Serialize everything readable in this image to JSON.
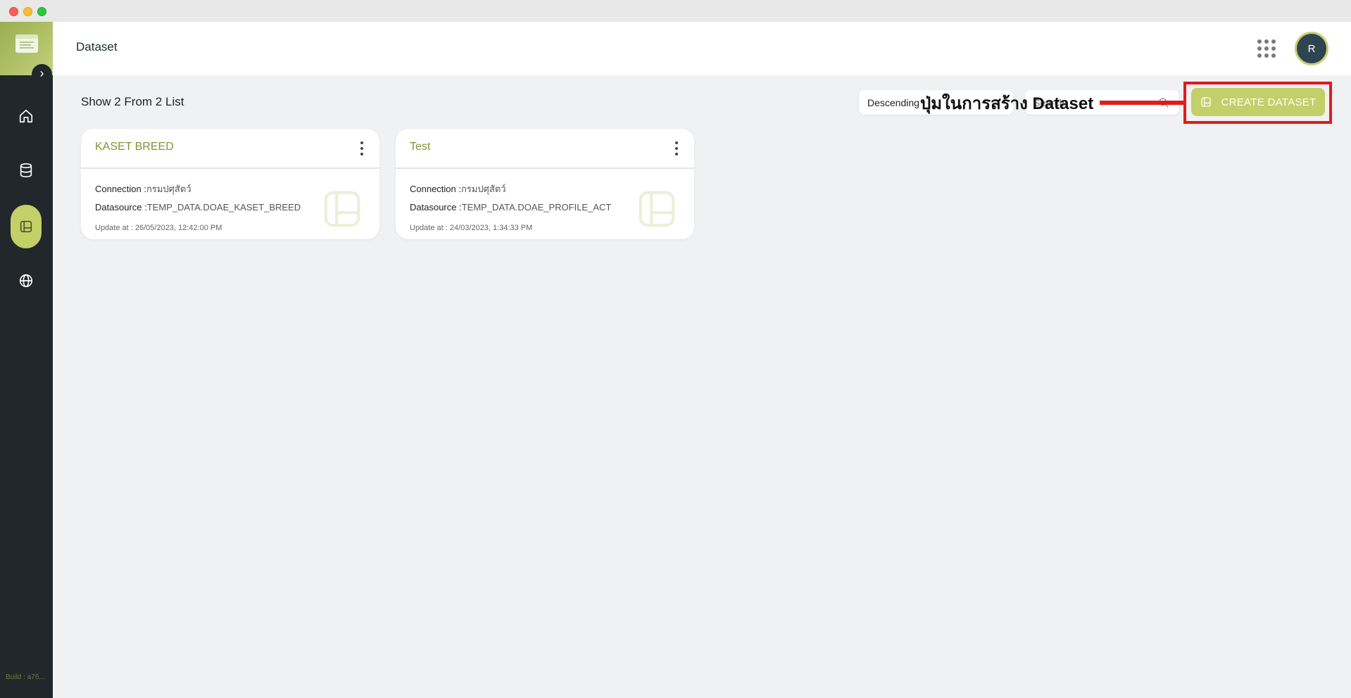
{
  "header": {
    "title": "Dataset",
    "avatar_initial": "R"
  },
  "sidebar": {
    "build": "Build : a76...",
    "items": [
      {
        "name": "home",
        "icon": "home-icon",
        "active": false
      },
      {
        "name": "database",
        "icon": "database-icon",
        "active": false
      },
      {
        "name": "dataset",
        "icon": "dataset-icon",
        "active": true
      },
      {
        "name": "globe",
        "icon": "globe-icon",
        "active": false
      }
    ]
  },
  "toolbar": {
    "count_label": "Show 2 From 2 List",
    "sort_value": "Descending",
    "search_placeholder": "Search",
    "create_label": "CREATE DATASET"
  },
  "annotation": {
    "text": "ปุ่มในการสร้าง Dataset",
    "color": "#e11b1b"
  },
  "cards": [
    {
      "title": "KASET BREED",
      "connection_label": "Connection :",
      "connection_value": "กรมปศุสัตว์",
      "datasource_label": "Datasource :",
      "datasource_value": "TEMP_DATA.DOAE_KASET_BREED",
      "update": "Update at : 26/05/2023, 12:42:00 PM"
    },
    {
      "title": "Test",
      "connection_label": "Connection :",
      "connection_value": "กรมปศุสัตว์",
      "datasource_label": "Datasource :",
      "datasource_value": "TEMP_DATA.DOAE_PROFILE_ACT",
      "update": "Update at : 24/03/2023, 1:34:33 PM"
    }
  ],
  "colors": {
    "accent": "#c3cf68",
    "title_green": "#7f9437",
    "sidebar_bg": "#22272b"
  }
}
